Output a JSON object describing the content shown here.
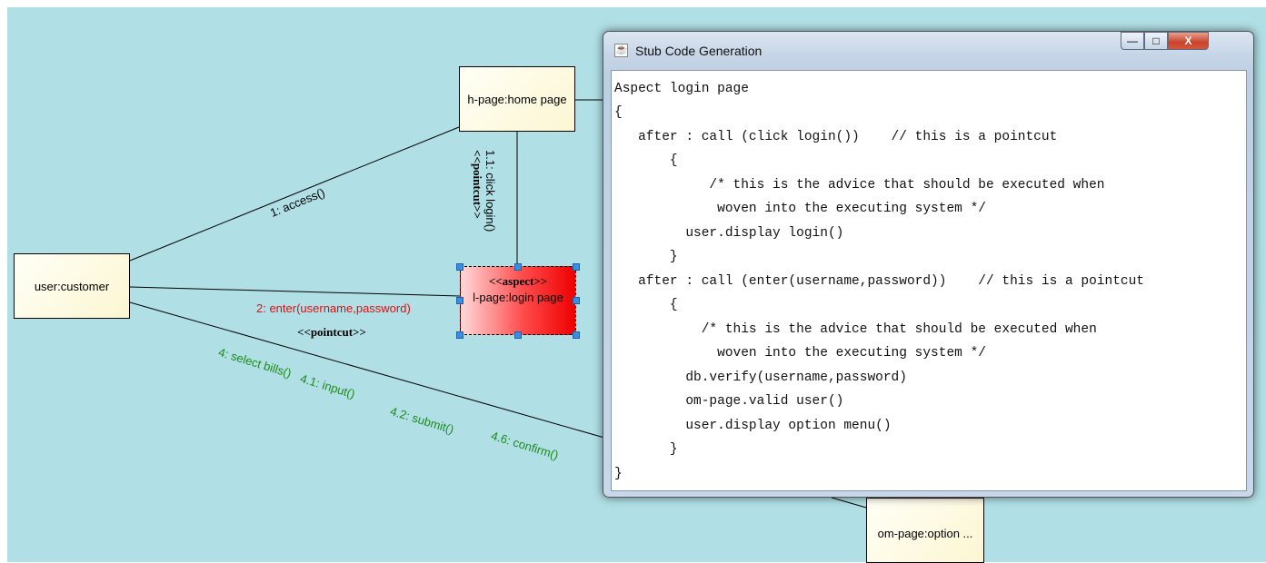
{
  "diagram": {
    "nodes": {
      "home_page": "h-page:home page",
      "customer": "user:customer",
      "login_stereotype": "<<aspect>>",
      "login_page": "l-page:login page",
      "option_menu": "om-page:option ..."
    },
    "messages": {
      "access": "1: access()",
      "click_login": "1.1: click login()",
      "click_login_stereo": "<<pointcut>>",
      "enter": "2: enter(username,password)",
      "enter_stereo": "<<pointcut>>",
      "select_bills": "4: select bills()",
      "input": "4.1: input()",
      "submit": "4.2: submit()",
      "confirm": "4.6: confirm()"
    },
    "colors": {
      "canvas": "#b0dfe5",
      "message_green": "#1e8a1e",
      "message_red": "#e01010",
      "aspect_fill": "#ee0000"
    }
  },
  "dialog": {
    "title": "Stub Code Generation",
    "app_icon": "java-cup-icon",
    "buttons": {
      "minimize": "—",
      "maximize": "□",
      "close": "X"
    },
    "code_lines": [
      "Aspect login page",
      "{",
      "   after : call (click login())    // this is a pointcut",
      "       {",
      "            /* this is the advice that should be executed when",
      "             woven into the executing system */",
      "         user.display login()",
      "       }",
      "   after : call (enter(username,password))    // this is a pointcut",
      "       {",
      "           /* this is the advice that should be executed when",
      "             woven into the executing system */",
      "         db.verify(username,password)",
      "         om-page.valid user()",
      "         user.display option menu()",
      "       }",
      "}"
    ]
  }
}
